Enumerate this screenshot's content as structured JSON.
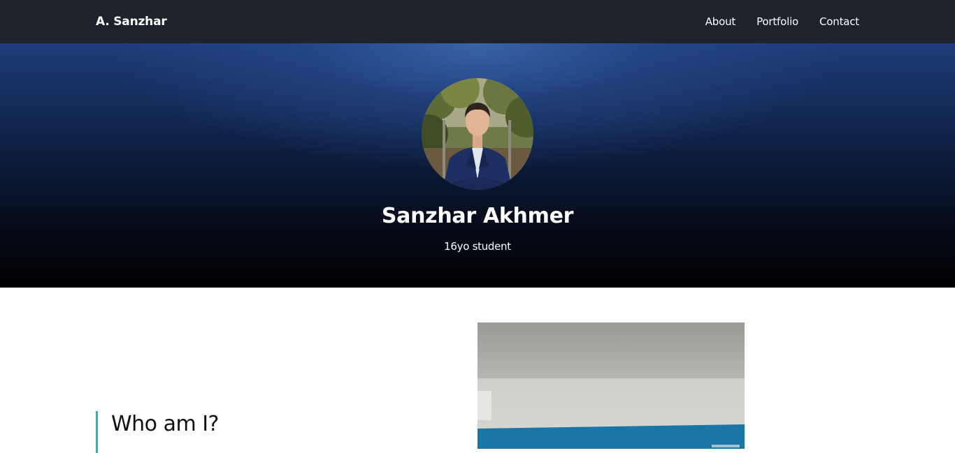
{
  "navbar": {
    "brand": "A. Sanzhar",
    "links": [
      {
        "label": "About"
      },
      {
        "label": "Portfolio"
      },
      {
        "label": "Contact"
      }
    ]
  },
  "hero": {
    "avatar_alt": "profile-photo",
    "name": "Sanzhar Akhmer",
    "subtitle": "16yo student"
  },
  "about": {
    "heading": "Who am I?",
    "photo_alt": "room-photo"
  },
  "colors": {
    "navbar_bg": "#1e232b",
    "hero_top": "#1d3e7a",
    "hero_bottom": "#000000",
    "accent": "#1fb6c9"
  }
}
